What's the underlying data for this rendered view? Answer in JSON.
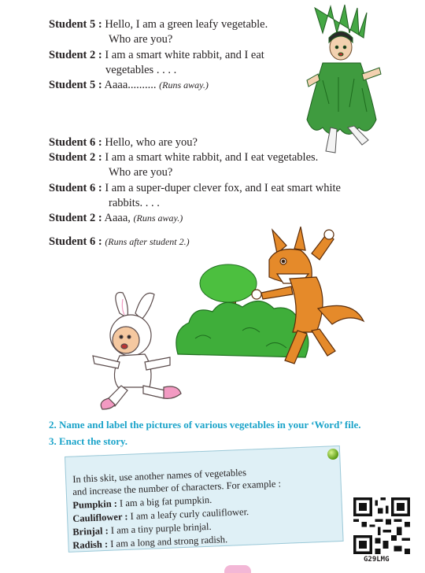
{
  "dialogue": [
    {
      "speaker": "Student 5 :",
      "text": "Hello, I am a green leafy vegetable.",
      "cont": "Who are you?"
    },
    {
      "speaker": "Student 2 :",
      "text": "I am a smart white rabbit, and I eat",
      "cont": "vegetables . . . ."
    },
    {
      "speaker": "Student 5 :",
      "text": "Aaaa..........",
      "stage": "(Runs away.)"
    },
    {
      "speaker": "Student 6 :",
      "text": "Hello, who are you?"
    },
    {
      "speaker": "Student 2 :",
      "text": "I am a smart white rabbit, and I eat vegetables.",
      "cont": "Who are you?"
    },
    {
      "speaker": "Student 6 :",
      "text": "I am a super-duper clever fox, and I eat smart white",
      "cont": "rabbits. . . ."
    },
    {
      "speaker": "Student 2 :",
      "text": "Aaaa,",
      "stage": "(Runs away.)"
    },
    {
      "speaker": "Student 6 :",
      "text": "",
      "stage": "(Runs after student 2.)"
    }
  ],
  "tasks": [
    "2.  Name and label the pictures of various vegetables in your ‘Word’ file.",
    "3.  Enact the story."
  ],
  "note": {
    "intro1": "In this skit, use another names of vegetables",
    "intro2": "and increase the number of characters. For example :",
    "examples": [
      {
        "label": "Pumpkin :",
        "text": "I am a big fat pumpkin."
      },
      {
        "label": "Cauliflower :",
        "text": "I am a leafy curly cauliflower."
      },
      {
        "label": "Brinjal :",
        "text": "I am a tiny purple brinjal."
      },
      {
        "label": "Radish :",
        "text": "I am a long and strong radish."
      }
    ]
  },
  "qr_code_label": "G29LMG",
  "colors": {
    "task_text": "#1aa3c9",
    "note_bg": "#dff0f6",
    "fox": "#e58a2a",
    "bush": "#3fae3a",
    "leafy": "#3a9a3a"
  }
}
